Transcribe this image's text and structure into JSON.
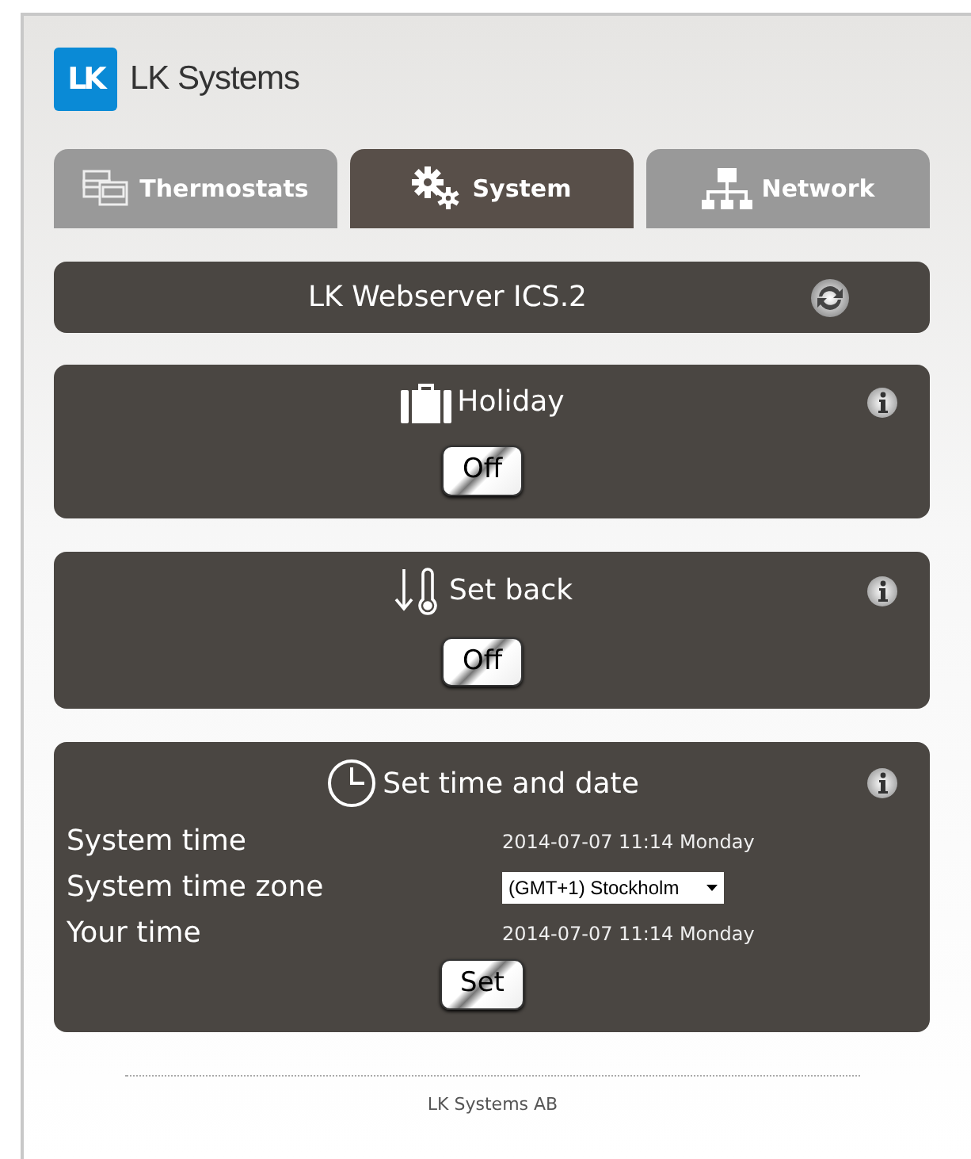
{
  "logo": {
    "mark": "LK",
    "name": "LK Systems"
  },
  "tabs": [
    {
      "label": "Thermostats",
      "selected": false
    },
    {
      "label": "System",
      "selected": true
    },
    {
      "label": "Network",
      "selected": false
    }
  ],
  "device_bar": {
    "title": "LK Webserver ICS.2"
  },
  "panels": [
    {
      "kind": "toggle",
      "title": "Holiday",
      "button": "Off"
    },
    {
      "kind": "toggle",
      "title": "Set back",
      "button": "Off"
    },
    {
      "kind": "time",
      "title": "Set time and date",
      "rows": [
        {
          "label": "System time",
          "kind": "text",
          "value": "2014-07-07 11:14 Monday"
        },
        {
          "label": "System time zone",
          "kind": "select",
          "value": "(GMT+1) Stockholm"
        },
        {
          "label": "Your time",
          "kind": "text",
          "value": "2014-07-07 11:14 Monday"
        }
      ],
      "button": "Set"
    }
  ],
  "footer": "LK Systems AB"
}
